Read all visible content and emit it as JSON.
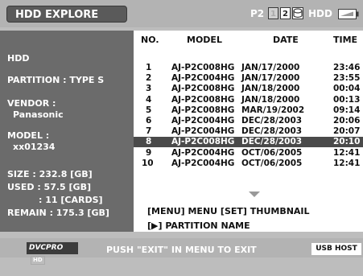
{
  "header": {
    "title": "HDD EXPLORE",
    "p2_label": "P2",
    "slots": [
      "1",
      "2"
    ],
    "hdd_label": "HDD"
  },
  "info": {
    "device": "HDD",
    "partition": "PARTITION : TYPE S",
    "vendor_label": "VENDOR :",
    "vendor_value": "Panasonic",
    "model_label": "MODEL :",
    "model_value": "xx01234",
    "size": "SIZE : 232.8 [GB]",
    "used": "USED :  57.5 [GB]",
    "cards": ": 11 [CARDS]",
    "remain": "REMAIN : 175.3 [GB]"
  },
  "table": {
    "columns": [
      "NO.",
      "MODEL",
      "DATE",
      "TIME"
    ],
    "selected_index": 7,
    "rows": [
      {
        "no": "1",
        "model": "AJ-P2C008HG",
        "date": "JAN/17/2000",
        "time": "23:46"
      },
      {
        "no": "2",
        "model": "AJ-P2C004HG",
        "date": "JAN/17/2000",
        "time": "23:55"
      },
      {
        "no": "3",
        "model": "AJ-P2C008HG",
        "date": "JAN/18/2000",
        "time": "00:04"
      },
      {
        "no": "4",
        "model": "AJ-P2C008HG",
        "date": "JAN/18/2000",
        "time": "00:13"
      },
      {
        "no": "5",
        "model": "AJ-P2C008HG",
        "date": "MAR/19/2002",
        "time": "09:14"
      },
      {
        "no": "6",
        "model": "AJ-P2C004HG",
        "date": "DEC/28/2003",
        "time": "20:06"
      },
      {
        "no": "7",
        "model": "AJ-P2C004HG",
        "date": "DEC/28/2003",
        "time": "20:07"
      },
      {
        "no": "8",
        "model": "AJ-P2C008HG",
        "date": "DEC/28/2003",
        "time": "20:10"
      },
      {
        "no": "9",
        "model": "AJ-P2C004HG",
        "date": "OCT/06/2005",
        "time": "12:41"
      },
      {
        "no": "10",
        "model": "AJ-P2C004HG",
        "date": "OCT/06/2005",
        "time": "12:41"
      }
    ]
  },
  "hints": {
    "line1": "[MENU] MENU   [SET] THUMBNAIL",
    "line2": "[▶] PARTITION NAME"
  },
  "footer": {
    "logo_text": "DVCPRO",
    "logo_hd": "HD",
    "status": "PUSH \"EXIT\" IN MENU TO EXIT",
    "usb": "USB HOST"
  },
  "icons": {
    "hdd": "hdd-icon",
    "battery": "battery-icon",
    "scroll_down": "triangle-down-icon"
  }
}
